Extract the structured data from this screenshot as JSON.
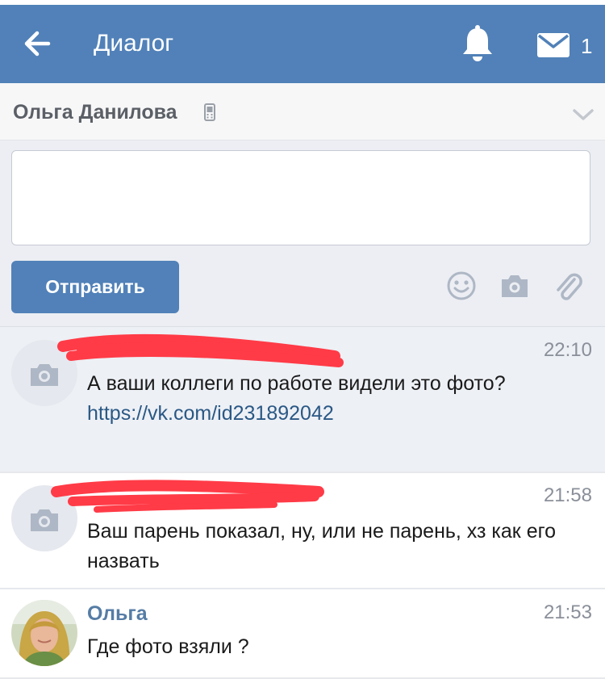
{
  "header": {
    "title": "Диалог",
    "mail_count": "1",
    "bg_color": "#5181b8"
  },
  "peer": {
    "name": "Ольга Данилова",
    "device_icon": "phone-icon"
  },
  "composer": {
    "input_value": "",
    "send_label": "Отправить",
    "tools": [
      "emoji-icon",
      "camera-icon",
      "paperclip-icon"
    ]
  },
  "dialogs": [
    {
      "avatar": "camera-placeholder",
      "sender_redacted": true,
      "time": "22:10",
      "text": "А ваши коллеги по работе видели это фото?",
      "link": "https://vk.com/id231892042",
      "unread": true
    },
    {
      "avatar": "camera-placeholder",
      "sender_redacted": true,
      "time": "21:58",
      "text": "Ваш парень показал, ну, или не парень, хз как его назвать",
      "unread": false
    },
    {
      "avatar": "photo",
      "sender": "Ольга",
      "time": "21:53",
      "text": "Где фото взяли ?",
      "unread": false
    }
  ],
  "colors": {
    "accent": "#5181b8",
    "unread_bg": "#edf0f5",
    "link": "#2a5885",
    "redaction": "#ff3b47"
  }
}
